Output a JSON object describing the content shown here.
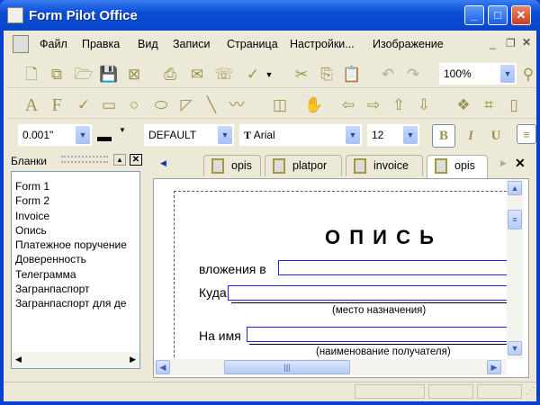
{
  "window": {
    "title": "Form Pilot Office"
  },
  "menu": [
    "Файл",
    "Правка",
    "Вид",
    "Записи",
    "Страница",
    "Настройки...",
    "Изображение"
  ],
  "toolbar": {
    "zoom": "100%",
    "line_width": "0.001\"",
    "style": "DEFAULT",
    "font": "Arial",
    "font_size": "12",
    "bold": "B",
    "italic": "I",
    "underline": "U",
    "text_tool": "A",
    "field_tool": "F"
  },
  "forms_panel": {
    "title": "Бланки",
    "items": [
      "Form 1",
      "Form 2",
      "Invoice",
      "Опись",
      "Платежное поручение",
      "Доверенность",
      "Телеграмма",
      "Загранпаспорт",
      "Загранпаспорт для де"
    ]
  },
  "tabs": [
    "opis",
    "platpor",
    "invoice",
    "opis"
  ],
  "document": {
    "heading": "О П И С Ь",
    "label_attachment": "вложения в",
    "label_destination": "Куда",
    "caption_destination": "(место назначения)",
    "label_recipient": "На имя",
    "caption_recipient": "(наименование получателя)"
  }
}
